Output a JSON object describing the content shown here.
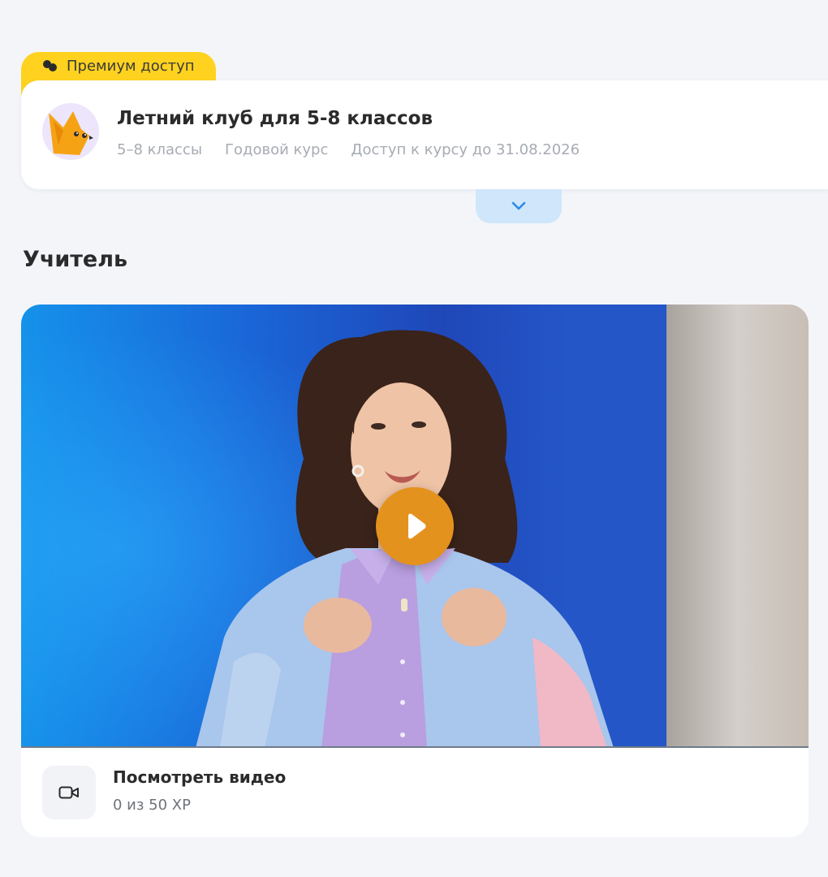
{
  "premium": {
    "label": "Премиум доступ",
    "color": "#ffd21f"
  },
  "course": {
    "title": "Летний клуб для 5-8 классов",
    "grades": "5–8 классы",
    "type": "Годовой курс",
    "access": "Доступ к курсу до 31.08.2026",
    "mascot_icon": "fox-mascot-icon"
  },
  "expand": {
    "icon": "chevron-down-icon",
    "color": "#cfe6fb"
  },
  "teacher_section": {
    "title": "Учитель"
  },
  "video": {
    "label": "Посмотреть видео",
    "xp": "0 из 50 XP",
    "play_icon": "play-icon",
    "camera_icon": "video-camera-icon",
    "play_color": "#e4921e"
  }
}
